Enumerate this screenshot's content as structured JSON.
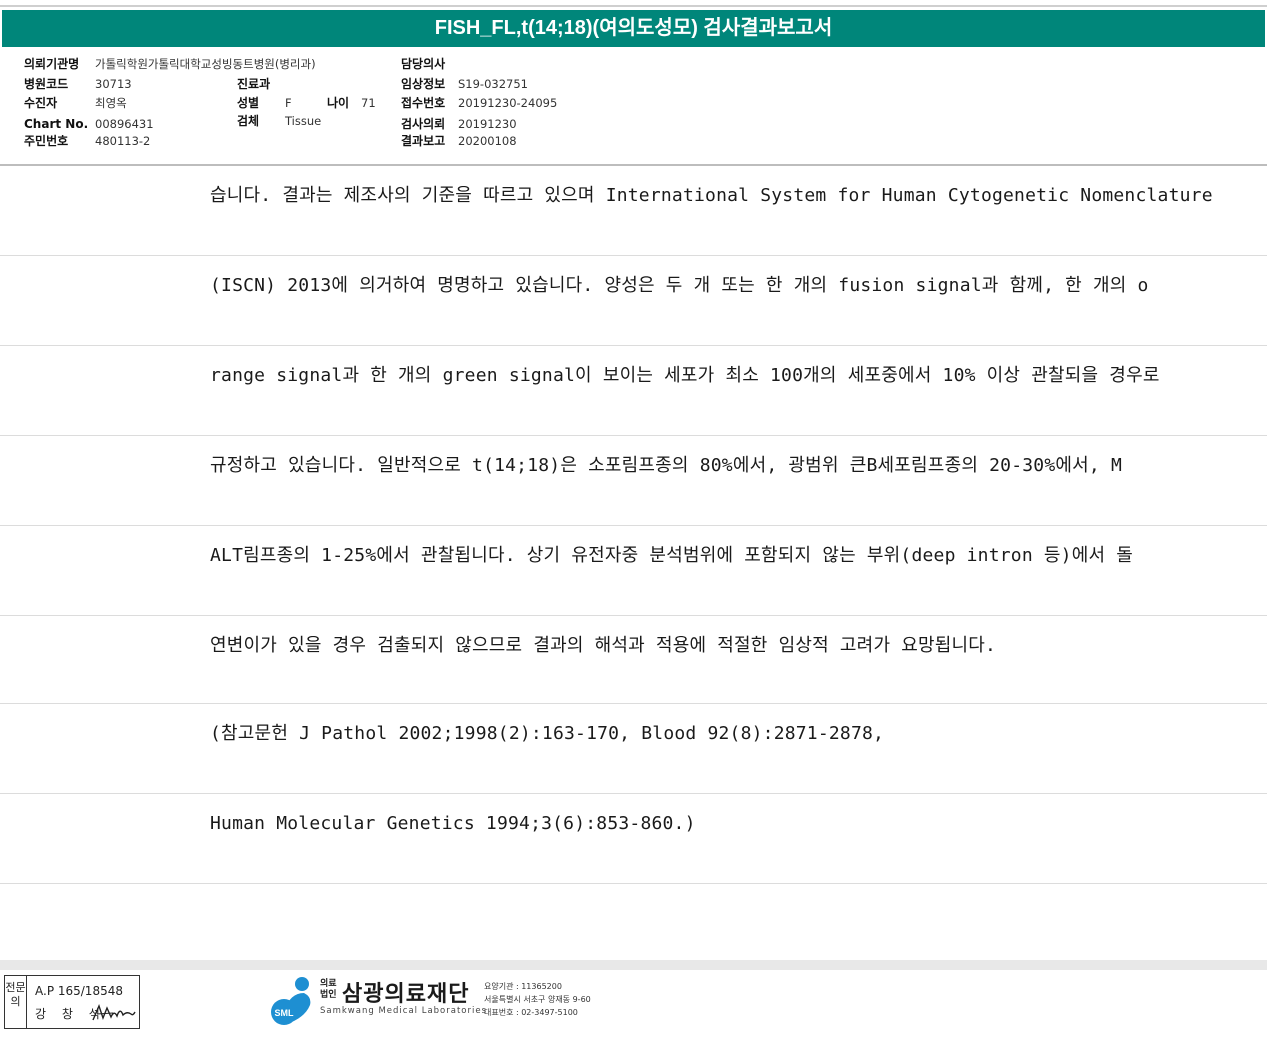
{
  "report": {
    "title": "FISH_FL,t(14;18)(여의도성모) 검사결과보고서"
  },
  "header": {
    "institution_label": "의뢰기관명",
    "institution_value": "가톨릭학원가톨릭대학교성빙동트병원(병리과)",
    "hospital_code_label": "병원코드",
    "hospital_code_value": "30713",
    "patient_label": "수진자",
    "patient_value": "최영옥",
    "chart_label": "Chart No.",
    "chart_value": "00896431",
    "resident_label": "주민번호",
    "resident_value": "480113-2",
    "department_label": "진료과",
    "department_value": "",
    "sex_label": "성별",
    "sex_value": "F",
    "age_label": "나이",
    "age_value": "71",
    "specimen_label": "검체",
    "specimen_value": "Tissue",
    "doctor_label": "담당의사",
    "doctor_value": "",
    "clinical_label": "임상정보",
    "clinical_value": "S19-032751",
    "receipt_label": "접수번호",
    "receipt_value": "20191230-24095",
    "request_label": "검사의뢰",
    "request_value": "20191230",
    "result_label": "결과보고",
    "result_value": "20200108"
  },
  "body_lines": [
    "습니다. 결과는 제조사의 기준을 따르고 있으며 International System for Human Cytogenetic Nomenclature",
    " (ISCN) 2013에 의거하여 명명하고 있습니다. 양성은 두 개 또는 한 개의 fusion signal과 함께, 한 개의 o",
    "range signal과 한 개의 green signal이 보이는 세포가 최소 100개의 세포중에서 10% 이상 관찰되을 경우로",
    " 규정하고 있습니다. 일반적으로 t(14;18)은 소포림프종의 80%에서, 광범위 큰B세포림프종의 20-30%에서, M",
    "ALT림프종의 1-25%에서 관찰됩니다. 상기 유전자중 분석범위에 포함되지 않는 부위(deep intron 등)에서 돌",
    "연변이가 있을 경우 검출되지 않으므로 결과의 해석과 적용에 적절한 임상적 고려가 요망됩니다.",
    "(참고문헌 J Pathol 2002;1998(2):163-170, Blood 92(8):2871-2878,",
    "Human Molecular Genetics 1994;3(6):853-860.)"
  ],
  "stamp": {
    "side_label": "전문의",
    "license": "A.P 165/18548",
    "name": "강 창 석"
  },
  "logo": {
    "prefix": "의료\n법인",
    "name_ko": "삼광의료재단",
    "name_en": "Samkwang Medical Laboratories",
    "mark_text": "SML",
    "info_line1": "요양기관 : 11365200",
    "info_line2": "서울특별시 서초구 양재동 9-60",
    "info_line3": "대표번호 : 02-3497-5100"
  },
  "colors": {
    "title_bar": "#00867a",
    "logo_blue": "#1e8fd2"
  }
}
